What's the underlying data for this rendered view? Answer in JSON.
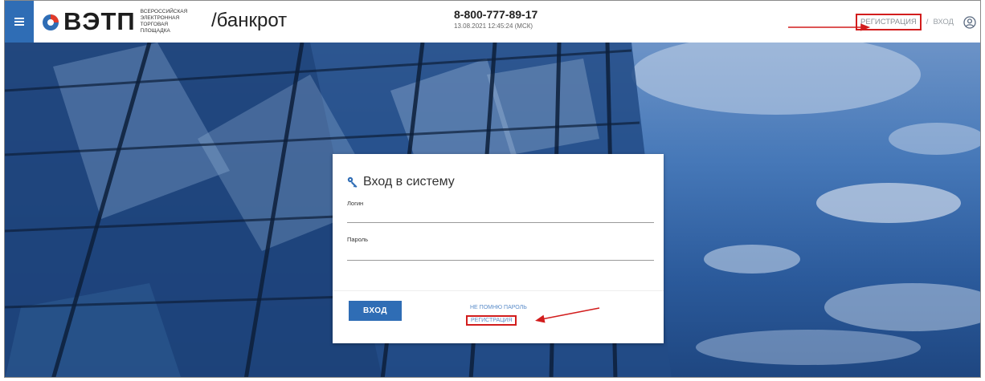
{
  "header": {
    "menu_icon": "hamburger-icon",
    "logo_text": "ВЭТП",
    "logo_subtitle_1": "ВСЕРОССИЙСКАЯ",
    "logo_subtitle_2": "ЭЛЕКТРОННАЯ",
    "logo_subtitle_3": "ТОРГОВАЯ ПЛОЩАДКА",
    "product": "/банкрот",
    "phone": "8-800-777-89-17",
    "datetime": "13.08.2021 12:45:24 (МСК)",
    "register_label": "РЕГИСТРАЦИЯ",
    "separator": "/",
    "login_label": "ВХОД",
    "user_icon": "user-circle-icon"
  },
  "login_form": {
    "title": "Вход в систему",
    "title_icon": "key-icon",
    "login_label": "Логин",
    "login_value": "",
    "password_label": "Пароль",
    "password_value": "",
    "submit_label": "ВХОД",
    "forgot_label": "НЕ ПОМНЮ ПАРОЛЬ",
    "register_label": "РЕГИСТРАЦИЯ"
  },
  "colors": {
    "brand_blue": "#2f6db5",
    "annotation_red": "#d21d1d",
    "link_blue": "#5b8cc9"
  }
}
